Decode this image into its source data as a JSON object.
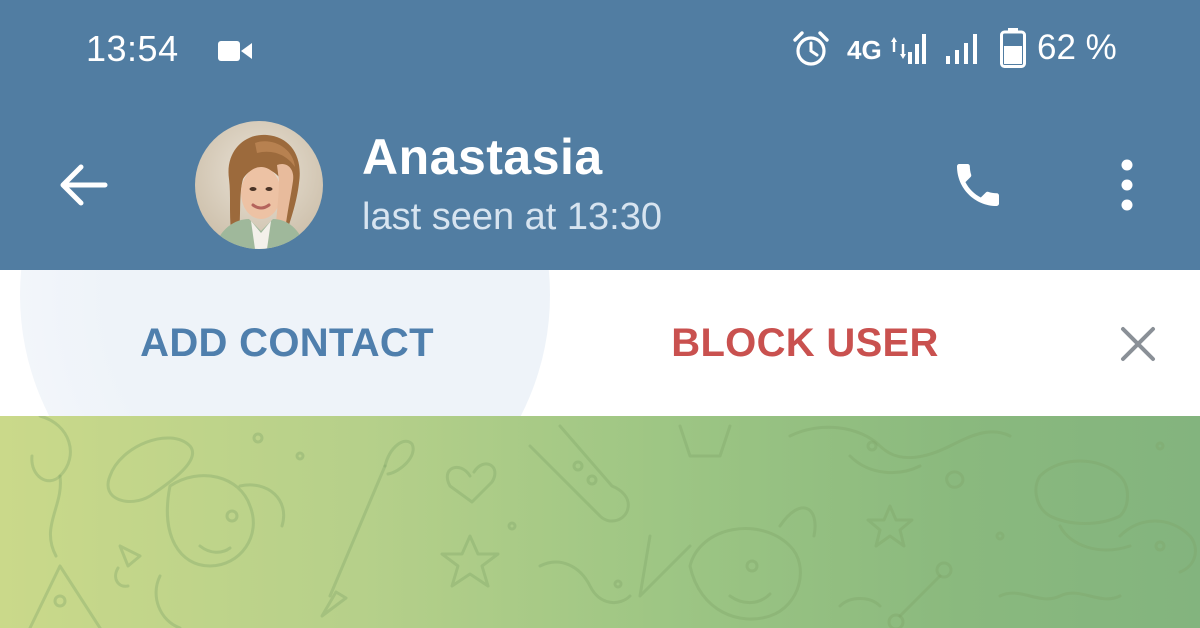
{
  "status_bar": {
    "time": "13:54",
    "network": "4G",
    "battery": "62 %",
    "battery_level": 0.62,
    "icons": [
      "video-camera-icon",
      "alarm-icon",
      "signal-icon",
      "battery-icon"
    ]
  },
  "header": {
    "contact_name": "Anastasia",
    "last_seen": "last seen at 13:30",
    "icons": [
      "back-arrow-icon",
      "phone-icon",
      "more-vert-icon"
    ]
  },
  "action_bar": {
    "add_contact_label": "ADD CONTACT",
    "block_user_label": "BLOCK USER",
    "close_icon": "close-icon"
  },
  "colors": {
    "header_bg": "#517da2",
    "add_contact": "#4f7fad",
    "block_user": "#c9514f",
    "close_icon": "#8a9097",
    "wallpaper_left": "#cad98a",
    "wallpaper_right": "#83b47e"
  }
}
